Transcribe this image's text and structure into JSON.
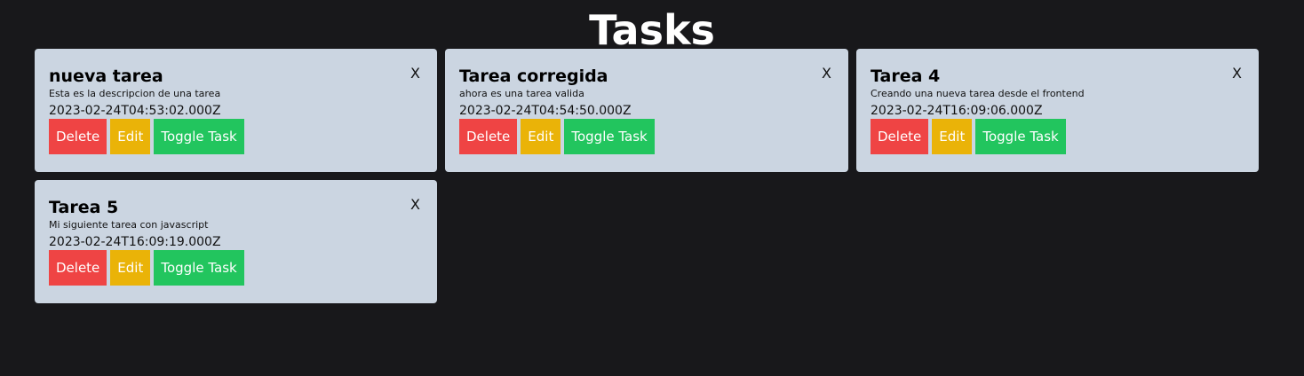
{
  "page": {
    "title": "Tasks"
  },
  "colors": {
    "background": "#18181b",
    "card": "#cbd5e1",
    "delete": "#ef4444",
    "edit": "#eab308",
    "toggle": "#22c55e"
  },
  "icons": {
    "close": "close-icon"
  },
  "buttons": {
    "delete": "Delete",
    "edit": "Edit",
    "toggle": "Toggle Task",
    "close": "X"
  },
  "tasks": [
    {
      "title": "nueva tarea",
      "description": "Esta es la descripcion de una tarea",
      "date": "2023-02-24T04:53:02.000Z"
    },
    {
      "title": "Tarea corregida",
      "description": "ahora es una tarea valida",
      "date": "2023-02-24T04:54:50.000Z"
    },
    {
      "title": "Tarea 4",
      "description": "Creando una nueva tarea desde el frontend",
      "date": "2023-02-24T16:09:06.000Z"
    },
    {
      "title": "Tarea 5",
      "description": "Mi siguiente tarea con javascript",
      "date": "2023-02-24T16:09:19.000Z"
    }
  ]
}
